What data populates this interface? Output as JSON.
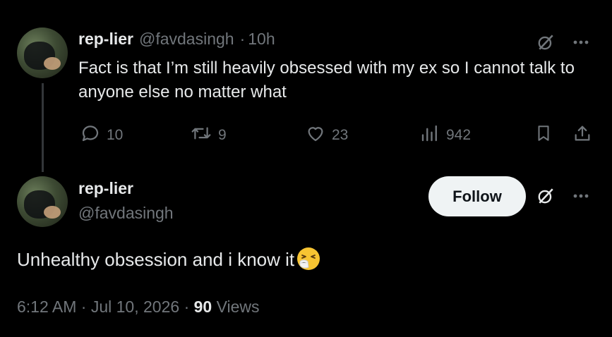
{
  "reply": {
    "display_name": "rep-lier",
    "handle": "@favdasingh",
    "separator": "·",
    "time": "10h",
    "text": "Fact is that I’m still heavily obsessed with my ex so I cannot talk to anyone else no matter what",
    "stats": {
      "replies": "10",
      "reposts": "9",
      "likes": "23",
      "views": "942"
    }
  },
  "main": {
    "display_name": "rep-lier",
    "handle": "@favdasingh",
    "follow_label": "Follow",
    "text": "Unhealthy obsession and i know it",
    "emoji": "sneezing-face-emoji",
    "meta": {
      "time": "6:12 AM",
      "dot": "·",
      "date": "Jul 10, 2026",
      "dot2": "·",
      "views_count": "90",
      "views_label": "Views"
    }
  },
  "icons": {
    "grok": "grok-icon",
    "more": "more-icon",
    "reply": "reply-icon",
    "repost": "repost-icon",
    "like": "like-icon",
    "views": "views-icon",
    "bookmark": "bookmark-icon",
    "share": "share-icon"
  },
  "colors": {
    "background": "#000000",
    "text": "#e7e9ea",
    "muted": "#71767b",
    "follow_bg": "#eff3f4"
  }
}
